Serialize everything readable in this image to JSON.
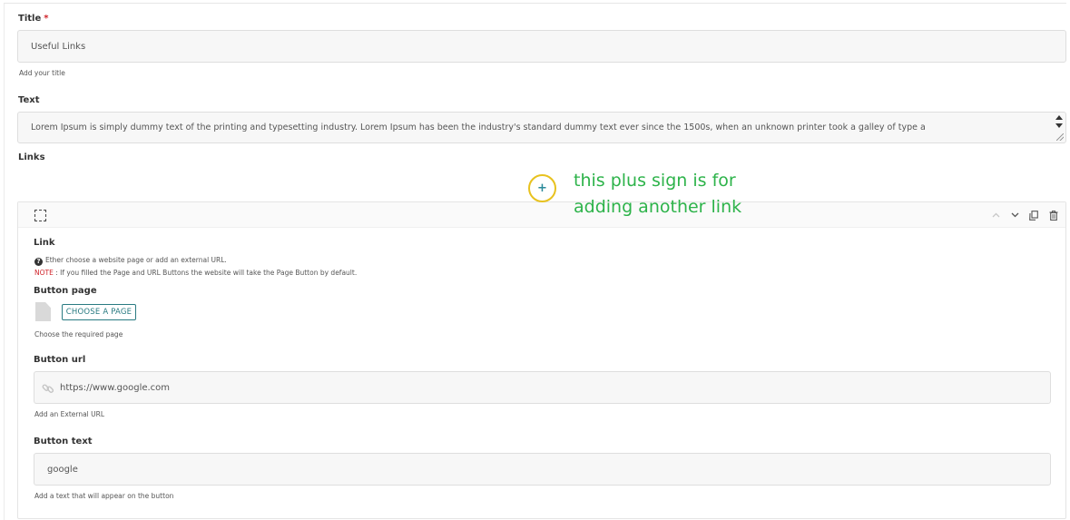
{
  "title_field": {
    "label": "Title",
    "required_mark": "*",
    "value": "Useful Links",
    "help": "Add your title"
  },
  "text_field": {
    "label": "Text",
    "value": "Lorem Ipsum is simply dummy text of the printing and typesetting industry. Lorem Ipsum has been the industry's standard dummy text ever since the 1500s, when an unknown printer took a galley of type a"
  },
  "links_section": {
    "label": "Links",
    "add_button": "+",
    "annotation_line1": "this plus sign is for",
    "annotation_line2": "adding another link"
  },
  "link_item": {
    "label": "Link",
    "info_text": "Ether choose a website page or add an external URL.",
    "note_prefix": "NOTE",
    "note_text": " : If you filled the Page and URL Buttons the website will take the Page Button by default.",
    "button_page": {
      "label": "Button page",
      "choose_label": "CHOOSE A PAGE",
      "help": "Choose the required page"
    },
    "button_url": {
      "label": "Button url",
      "value": "https://www.google.com",
      "help": "Add an External URL"
    },
    "button_text": {
      "label": "Button text",
      "value": "google",
      "help": "Add a text that will appear on the button"
    },
    "controls": [
      "chevron-up-icon",
      "chevron-down-icon",
      "copy-icon",
      "trash-icon"
    ]
  },
  "colors": {
    "accent": "#2a7b82",
    "required": "#d0232a",
    "annotation": "#2db34a",
    "highlight_ring": "#e8c21f"
  }
}
